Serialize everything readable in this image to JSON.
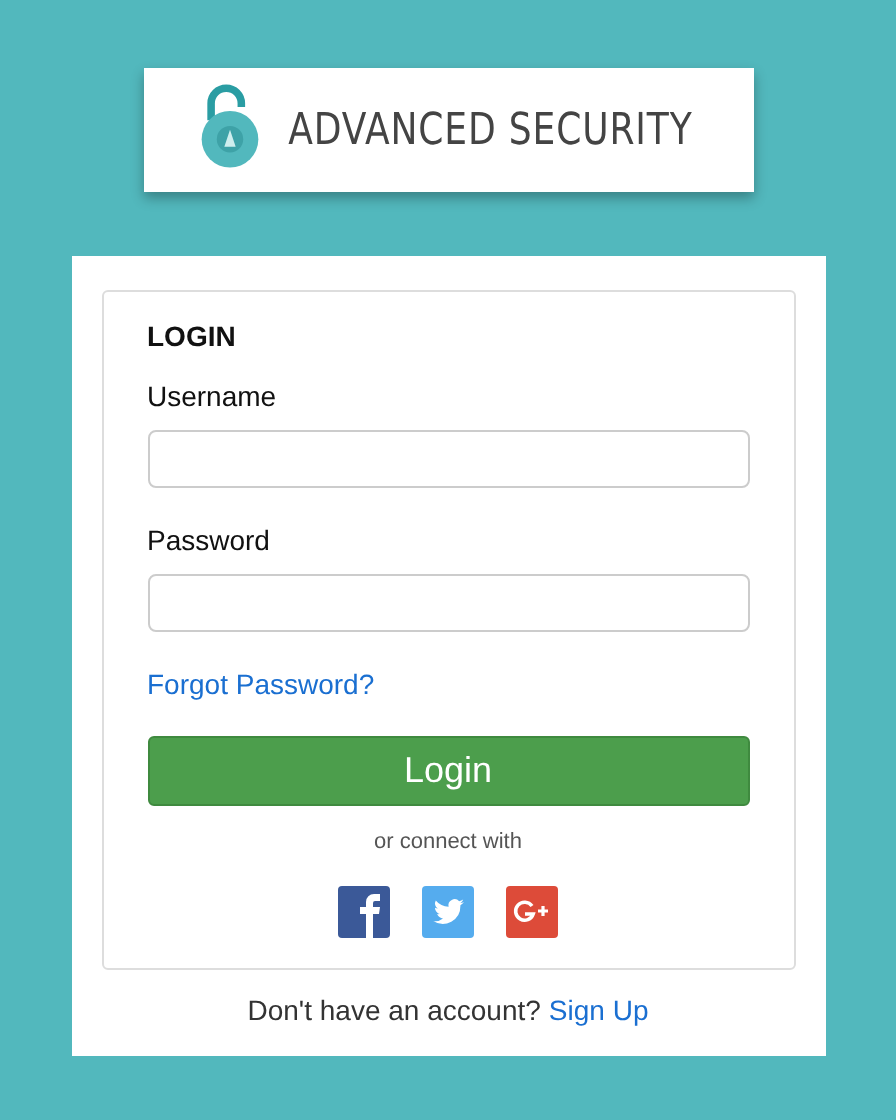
{
  "brand": {
    "title": "ADVANCED SECURITY"
  },
  "login": {
    "heading": "LOGIN",
    "fields": [
      {
        "label": "Username"
      },
      {
        "label": "Password"
      }
    ],
    "forgot_link": "Forgot Password?",
    "submit": "Login",
    "connect_text": "or connect with",
    "social": [
      {
        "kind": "facebook",
        "color": "#3b5998"
      },
      {
        "kind": "twitter",
        "color": "#55acee"
      },
      {
        "kind": "google",
        "color": "#dd4b39"
      }
    ]
  },
  "signup": {
    "text": "Don't have an account?",
    "link": "Sign Up"
  }
}
